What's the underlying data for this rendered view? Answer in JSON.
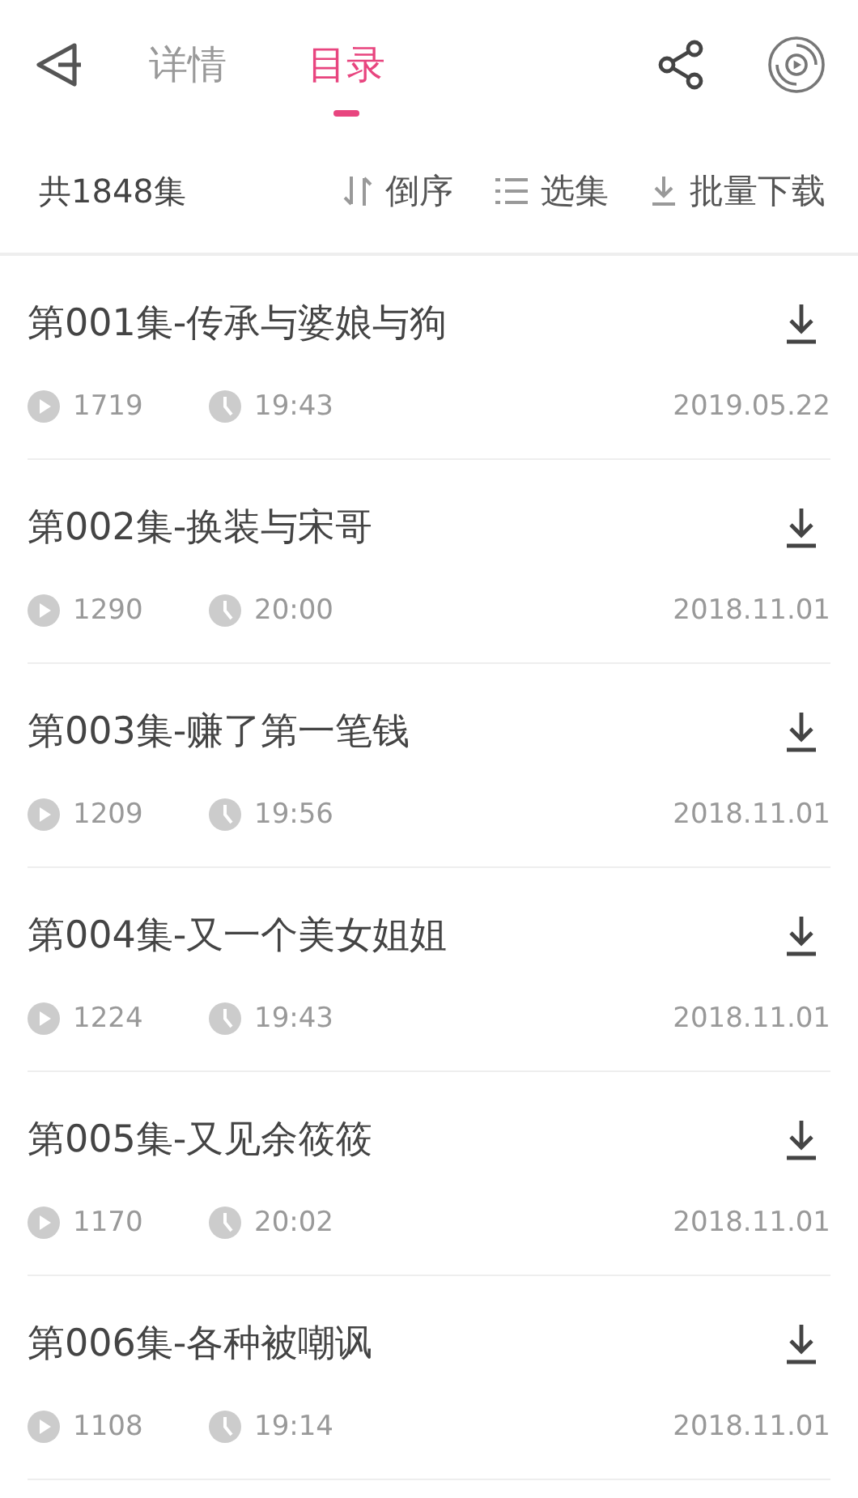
{
  "tabs": [
    {
      "label": "详情",
      "selected": false
    },
    {
      "label": "目录",
      "selected": true
    }
  ],
  "toolbar": {
    "count": "共1848集",
    "sort": "倒序",
    "select": "选集",
    "batch_download": "批量下载"
  },
  "episodes": [
    {
      "title": "第001集-传承与婆娘与狗",
      "plays": "1719",
      "duration": "19:43",
      "date": "2019.05.22"
    },
    {
      "title": "第002集-换装与宋哥",
      "plays": "1290",
      "duration": "20:00",
      "date": "2018.11.01"
    },
    {
      "title": "第003集-赚了第一笔钱",
      "plays": "1209",
      "duration": "19:56",
      "date": "2018.11.01"
    },
    {
      "title": "第004集-又一个美女姐姐",
      "plays": "1224",
      "duration": "19:43",
      "date": "2018.11.01"
    },
    {
      "title": "第005集-又见余筱筱",
      "plays": "1170",
      "duration": "20:02",
      "date": "2018.11.01"
    },
    {
      "title": "第006集-各种被嘲讽",
      "plays": "1108",
      "duration": "19:14",
      "date": "2018.11.01"
    }
  ]
}
